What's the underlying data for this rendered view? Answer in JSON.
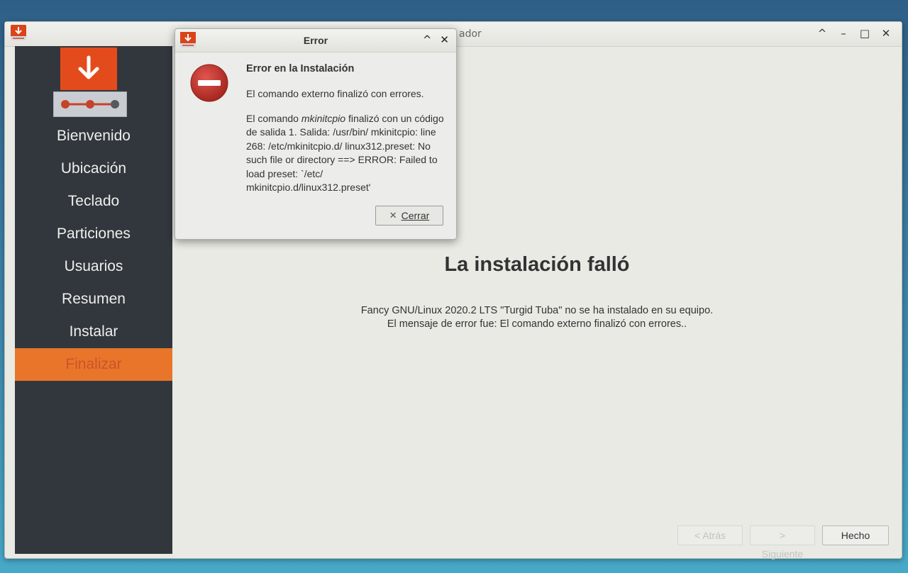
{
  "window": {
    "title": "ador",
    "controls": [
      "^",
      "–",
      "□",
      "✕"
    ]
  },
  "sidebar": {
    "items": [
      {
        "label": "Bienvenido"
      },
      {
        "label": "Ubicación"
      },
      {
        "label": "Teclado"
      },
      {
        "label": "Particiones"
      },
      {
        "label": "Usuarios"
      },
      {
        "label": "Resumen"
      },
      {
        "label": "Instalar"
      },
      {
        "label": "Finalizar",
        "active": true
      }
    ]
  },
  "main": {
    "headline": "La instalación falló",
    "message_line1": "Fancy GNU/Linux 2020.2 LTS \"Turgid Tuba\" no se ha instalado en su equipo.",
    "message_line2": "El mensaje de error fue: El comando externo finalizó con errores..",
    "buttons": {
      "back": "< Atrás",
      "next": "> Siguiente",
      "done": "Hecho"
    }
  },
  "dialog": {
    "title": "Error",
    "controls": [
      "^",
      "✕"
    ],
    "heading": "Error en la Instalación",
    "summary": "El comando externo finalizó con errores.",
    "detail_prefix": "El comando ",
    "detail_command": "mkinitcpio",
    "detail_rest": " finalizó con un código de salida 1. Salida: /usr/bin/ mkinitcpio: line 268: /etc/mkinitcpio.d/ linux312.preset: No such file or directory ==> ERROR: Failed to load preset: `/etc/ mkinitcpio.d/linux312.preset'",
    "close_label": "Cerrar"
  },
  "colors": {
    "accent": "#e8752a",
    "brand": "#e44b1c",
    "sidebar_bg": "#32363d",
    "error_red": "#c9302c"
  },
  "icons": [
    "download-arrow-icon",
    "timeline-icon",
    "error-icon",
    "close-x-icon",
    "maximize-icon",
    "minimize-icon",
    "chevron-up-icon"
  ]
}
